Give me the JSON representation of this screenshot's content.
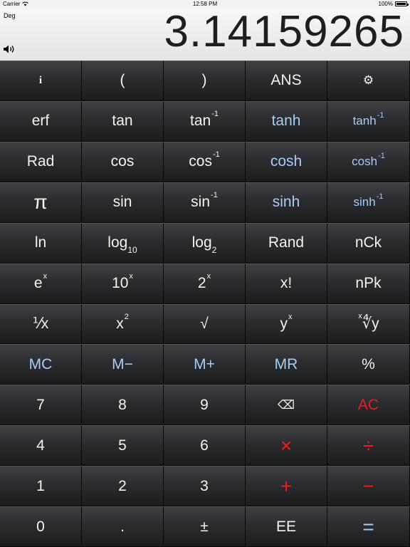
{
  "status": {
    "carrier": "Carrier",
    "time": "12:58 PM",
    "battery": "100%"
  },
  "display": {
    "mode": "Deg",
    "value": "3.14159265"
  },
  "keys": [
    {
      "name": "info-key",
      "label": "i",
      "cls": "info"
    },
    {
      "name": "open-paren-key",
      "label": "("
    },
    {
      "name": "close-paren-key",
      "label": ")"
    },
    {
      "name": "ans-key",
      "label": "ANS"
    },
    {
      "name": "settings-key",
      "icon": "gear-icon",
      "label": "⚙",
      "cls": "small"
    },
    {
      "name": "erf-key",
      "label": "erf"
    },
    {
      "name": "tan-key",
      "label": "tan"
    },
    {
      "name": "arctan-key",
      "label": "tan",
      "sup": "-1"
    },
    {
      "name": "tanh-key",
      "label": "tanh",
      "cls": "blue"
    },
    {
      "name": "arctanh-key",
      "label": "tanh",
      "sup": "-1",
      "cls": "blue small"
    },
    {
      "name": "rad-key",
      "label": "Rad"
    },
    {
      "name": "cos-key",
      "label": "cos"
    },
    {
      "name": "arccos-key",
      "label": "cos",
      "sup": "-1"
    },
    {
      "name": "cosh-key",
      "label": "cosh",
      "cls": "blue"
    },
    {
      "name": "arccosh-key",
      "label": "cosh",
      "sup": "-1",
      "cls": "blue small"
    },
    {
      "name": "pi-key",
      "label": "π",
      "cls": "big"
    },
    {
      "name": "sin-key",
      "label": "sin"
    },
    {
      "name": "arcsin-key",
      "label": "sin",
      "sup": "-1"
    },
    {
      "name": "sinh-key",
      "label": "sinh",
      "cls": "blue"
    },
    {
      "name": "arcsinh-key",
      "label": "sinh",
      "sup": "-1",
      "cls": "blue small"
    },
    {
      "name": "ln-key",
      "label": "ln"
    },
    {
      "name": "log10-key",
      "label": "log",
      "sub": "10"
    },
    {
      "name": "log2-key",
      "label": "log",
      "sub": "2"
    },
    {
      "name": "rand-key",
      "label": "Rand"
    },
    {
      "name": "nck-key",
      "label": "nCk"
    },
    {
      "name": "exp-key",
      "label": "e",
      "sup": "x"
    },
    {
      "name": "ten-power-key",
      "label": "10",
      "sup": "x"
    },
    {
      "name": "two-power-key",
      "label": "2",
      "sup": "x"
    },
    {
      "name": "factorial-key",
      "label": "x!"
    },
    {
      "name": "npk-key",
      "label": "nPk"
    },
    {
      "name": "reciprocal-key",
      "label": "⅟x"
    },
    {
      "name": "square-key",
      "label": "x",
      "sup": "2"
    },
    {
      "name": "sqrt-key",
      "label": "√"
    },
    {
      "name": "y-power-x-key",
      "label": "y",
      "sup": "x"
    },
    {
      "name": "x-root-y-key",
      "label": "∜y",
      "sup": "x"
    },
    {
      "name": "memory-clear-key",
      "label": "MC",
      "cls": "blue"
    },
    {
      "name": "memory-minus-key",
      "label": "M−",
      "cls": "blue"
    },
    {
      "name": "memory-plus-key",
      "label": "M+",
      "cls": "blue"
    },
    {
      "name": "memory-recall-key",
      "label": "MR",
      "cls": "blue"
    },
    {
      "name": "percent-key",
      "label": "%"
    },
    {
      "name": "digit-7-key",
      "label": "7"
    },
    {
      "name": "digit-8-key",
      "label": "8"
    },
    {
      "name": "digit-9-key",
      "label": "9"
    },
    {
      "name": "backspace-key",
      "icon": "backspace-icon",
      "label": "⌫",
      "cls": "small"
    },
    {
      "name": "all-clear-key",
      "label": "AC",
      "cls": "red"
    },
    {
      "name": "digit-4-key",
      "label": "4"
    },
    {
      "name": "digit-5-key",
      "label": "5"
    },
    {
      "name": "digit-6-key",
      "label": "6"
    },
    {
      "name": "multiply-key",
      "label": "×",
      "cls": "red big"
    },
    {
      "name": "divide-key",
      "label": "÷",
      "cls": "red big"
    },
    {
      "name": "digit-1-key",
      "label": "1"
    },
    {
      "name": "digit-2-key",
      "label": "2"
    },
    {
      "name": "digit-3-key",
      "label": "3"
    },
    {
      "name": "add-key",
      "label": "+",
      "cls": "red big"
    },
    {
      "name": "subtract-key",
      "label": "−",
      "cls": "red big"
    },
    {
      "name": "digit-0-key",
      "label": "0"
    },
    {
      "name": "decimal-key",
      "label": "."
    },
    {
      "name": "plus-minus-key",
      "label": "±"
    },
    {
      "name": "ee-key",
      "label": "EE"
    },
    {
      "name": "equals-key",
      "label": "=",
      "cls": "blue big"
    }
  ]
}
